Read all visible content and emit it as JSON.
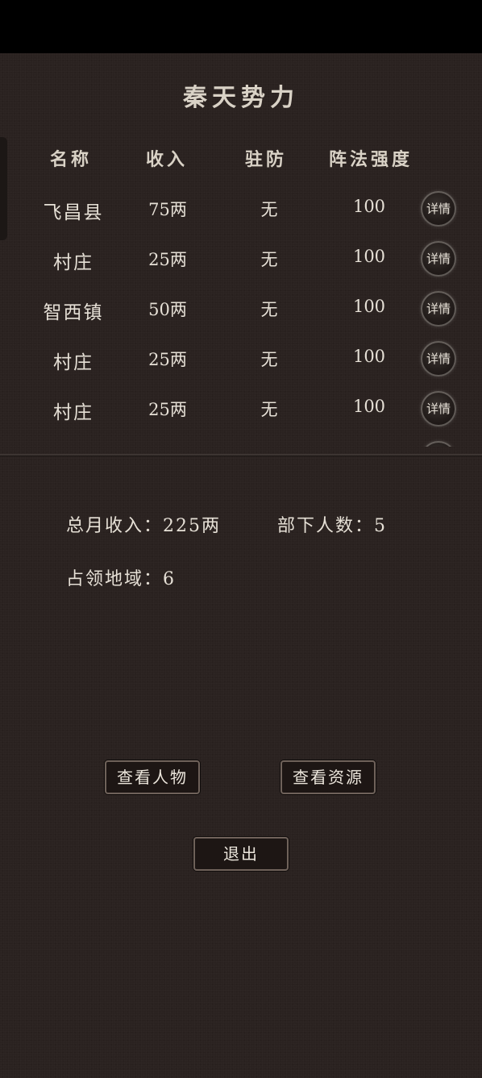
{
  "title": "秦天势力",
  "columns": {
    "name": "名称",
    "income": "收入",
    "garrison": "驻防",
    "formation": "阵法强度"
  },
  "rows": [
    {
      "name": "飞昌县",
      "income": "75两",
      "garrison": "无",
      "formation": "100",
      "detail_label": "详情"
    },
    {
      "name": "村庄",
      "income": "25两",
      "garrison": "无",
      "formation": "100",
      "detail_label": "详情"
    },
    {
      "name": "智西镇",
      "income": "50两",
      "garrison": "无",
      "formation": "100",
      "detail_label": "详情"
    },
    {
      "name": "村庄",
      "income": "25两",
      "garrison": "无",
      "formation": "100",
      "detail_label": "详情"
    },
    {
      "name": "村庄",
      "income": "25两",
      "garrison": "无",
      "formation": "100",
      "detail_label": "详情"
    },
    {
      "name": "",
      "income": "",
      "garrison": "",
      "formation": "",
      "detail_label": "详情"
    }
  ],
  "summary": {
    "total_income": "总月收入：225两",
    "subordinates": "部下人数：5",
    "territories": "占领地域：6"
  },
  "buttons": {
    "view_characters": "查看人物",
    "view_resources": "查看资源",
    "exit": "退出"
  }
}
